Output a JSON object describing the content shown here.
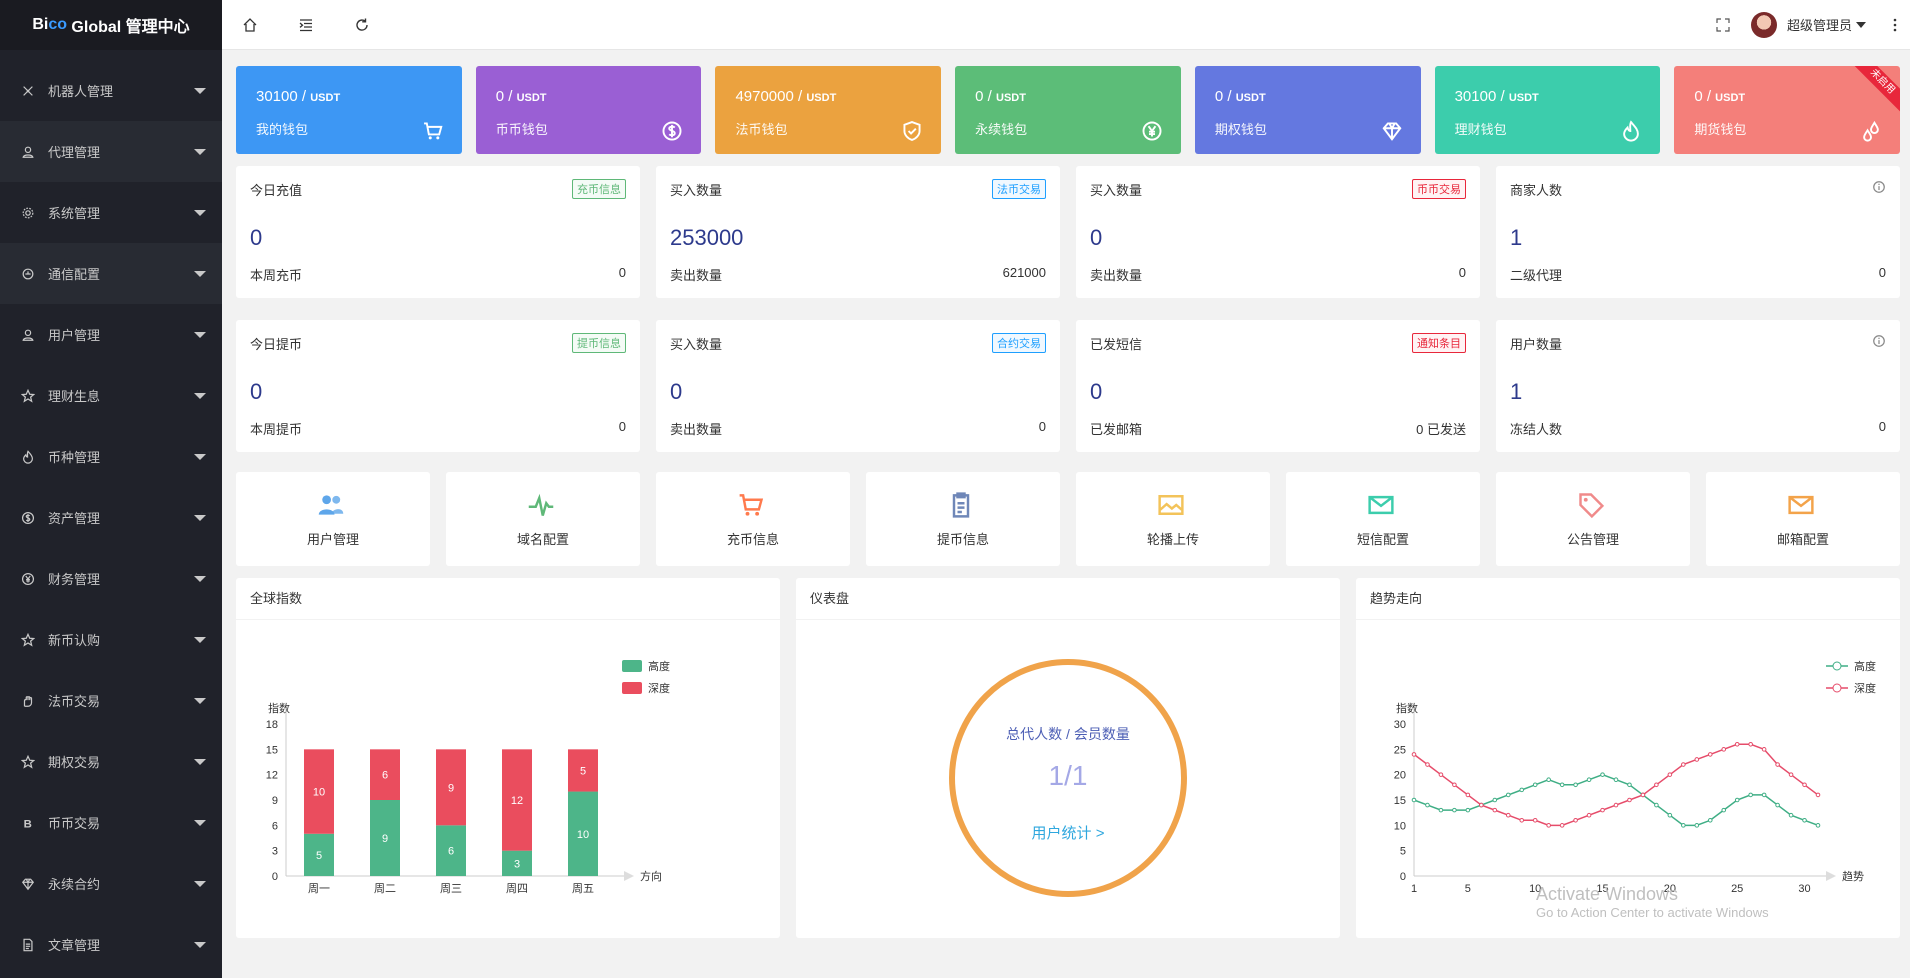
{
  "app": {
    "logo_prefix": "Bi",
    "logo_accent": "co",
    "logo_rest": " Global 管理中心"
  },
  "sidebar": {
    "items": [
      {
        "label": "机器人管理",
        "icon": "robot-icon"
      },
      {
        "label": "代理管理",
        "icon": "user-icon"
      },
      {
        "label": "系统管理",
        "icon": "gear-icon"
      },
      {
        "label": "通信配置",
        "icon": "signal-icon"
      },
      {
        "label": "用户管理",
        "icon": "user-icon"
      },
      {
        "label": "理财生息",
        "icon": "star-icon"
      },
      {
        "label": "币种管理",
        "icon": "fire-icon"
      },
      {
        "label": "资产管理",
        "icon": "dollar-icon"
      },
      {
        "label": "财务管理",
        "icon": "yen-icon"
      },
      {
        "label": "新币认购",
        "icon": "star-icon"
      },
      {
        "label": "法币交易",
        "icon": "hand-icon"
      },
      {
        "label": "期权交易",
        "icon": "star-icon"
      },
      {
        "label": "币币交易",
        "icon": "b-icon"
      },
      {
        "label": "永续合约",
        "icon": "diamond-icon"
      },
      {
        "label": "文章管理",
        "icon": "doc-icon"
      }
    ]
  },
  "header": {
    "username": "超级管理员"
  },
  "wallets": [
    {
      "amount": "30100 / ",
      "unit": "USDT",
      "name": "我的钱包",
      "color": "#3d97f4",
      "icon": "cart-icon"
    },
    {
      "amount": "0 / ",
      "unit": "USDT",
      "name": "币币钱包",
      "color": "#9a5fd4",
      "icon": "dollar-icon"
    },
    {
      "amount": "4970000 / ",
      "unit": "USDT",
      "name": "法币钱包",
      "color": "#eba23f",
      "icon": "shield-check-icon"
    },
    {
      "amount": "0 / ",
      "unit": "USDT",
      "name": "永续钱包",
      "color": "#5cbd78",
      "icon": "yen-icon"
    },
    {
      "amount": "0 / ",
      "unit": "USDT",
      "name": "期权钱包",
      "color": "#6478e0",
      "icon": "diamond-icon"
    },
    {
      "amount": "30100 / ",
      "unit": "USDT",
      "name": "理财钱包",
      "color": "#3ccdac",
      "icon": "fire-icon"
    },
    {
      "amount": "0 / ",
      "unit": "USDT",
      "name": "期货钱包",
      "color": "#f47f7a",
      "icon": "drops-icon",
      "ribbon": "未启用"
    }
  ],
  "stats_row1": [
    {
      "title": "今日充值",
      "badge": "充币信息",
      "badge_color": "green",
      "value": "0",
      "bottom_label": "本周充币",
      "bottom_value": "0"
    },
    {
      "title": "买入数量",
      "badge": "法币交易",
      "badge_color": "blue",
      "value": "253000",
      "bottom_label": "卖出数量",
      "bottom_value": "621000"
    },
    {
      "title": "买入数量",
      "badge": "币币交易",
      "badge_color": "red2",
      "value": "0",
      "bottom_label": "卖出数量",
      "bottom_value": "0"
    },
    {
      "title": "商家人数",
      "badge": "",
      "badge_color": "info",
      "value": "1",
      "bottom_label": "二级代理",
      "bottom_value": "0"
    }
  ],
  "stats_row2": [
    {
      "title": "今日提币",
      "badge": "提币信息",
      "badge_color": "green",
      "value": "0",
      "bottom_label": "本周提币",
      "bottom_value": "0"
    },
    {
      "title": "买入数量",
      "badge": "合约交易",
      "badge_color": "blue",
      "value": "0",
      "bottom_label": "卖出数量",
      "bottom_value": "0"
    },
    {
      "title": "已发短信",
      "badge": "通知条目",
      "badge_color": "red2",
      "value": "0",
      "bottom_label": "已发邮箱",
      "bottom_value": "0 已发送"
    },
    {
      "title": "用户数量",
      "badge": "",
      "badge_color": "info",
      "value": "1",
      "bottom_label": "冻结人数",
      "bottom_value": "0"
    }
  ],
  "quick": [
    {
      "label": "用户管理",
      "icon": "users-icon",
      "color": "#5ea6ea"
    },
    {
      "label": "域名配置",
      "icon": "pulse-icon",
      "color": "#5fb878"
    },
    {
      "label": "充币信息",
      "icon": "cart-icon",
      "color": "#ff7a4d"
    },
    {
      "label": "提币信息",
      "icon": "clipboard-icon",
      "color": "#6f87b8"
    },
    {
      "label": "轮播上传",
      "icon": "image-icon",
      "color": "#f3c35a"
    },
    {
      "label": "短信配置",
      "icon": "mail-icon",
      "color": "#3ccdac"
    },
    {
      "label": "公告管理",
      "icon": "tag-icon",
      "color": "#f08a8a"
    },
    {
      "label": "邮箱配置",
      "icon": "mail-icon",
      "color": "#f3a34a"
    }
  ],
  "panels": {
    "bar_title": "全球指数",
    "gauge_title": "仪表盘",
    "line_title": "趋势走向",
    "gauge": {
      "label": "总代人数 / 会员数量",
      "value": "1/1",
      "link": "用户统计 >"
    }
  },
  "chart_data": [
    {
      "type": "bar",
      "stacked": true,
      "title": "",
      "ylabel": "指数",
      "xlabel": "方向",
      "categories": [
        "周一",
        "周二",
        "周三",
        "周四",
        "周五"
      ],
      "series": [
        {
          "name": "高度",
          "color": "#4db589",
          "values": [
            5,
            9,
            6,
            3,
            10
          ]
        },
        {
          "name": "深度",
          "color": "#ea4d5e",
          "values": [
            10,
            6,
            9,
            12,
            5
          ]
        }
      ],
      "yticks": [
        0,
        3,
        6,
        9,
        12,
        15,
        18
      ],
      "ylim": [
        0,
        18
      ],
      "legend": "top-right"
    },
    {
      "type": "line",
      "title": "",
      "ylabel": "指数",
      "xlabel": "趋势",
      "x": [
        1,
        2,
        3,
        4,
        5,
        6,
        7,
        8,
        9,
        10,
        11,
        12,
        13,
        14,
        15,
        16,
        17,
        18,
        19,
        20,
        21,
        22,
        23,
        24,
        25,
        26,
        27,
        28,
        29,
        30,
        31
      ],
      "xticks": [
        1,
        5,
        10,
        15,
        20,
        25,
        30
      ],
      "series": [
        {
          "name": "高度",
          "color": "#3fae85",
          "values": [
            15,
            14,
            13,
            13,
            13,
            14,
            15,
            16,
            17,
            18,
            19,
            18,
            18,
            19,
            20,
            19,
            18,
            16,
            14,
            12,
            10,
            10,
            11,
            13,
            15,
            16,
            16,
            14,
            12,
            11,
            10
          ]
        },
        {
          "name": "深度",
          "color": "#e64c6a",
          "values": [
            24,
            22,
            20,
            18,
            16,
            14,
            13,
            12,
            11,
            11,
            10,
            10,
            11,
            12,
            13,
            14,
            15,
            16,
            18,
            20,
            22,
            23,
            24,
            25,
            26,
            26,
            25,
            22,
            20,
            18,
            16
          ]
        }
      ],
      "yticks": [
        0,
        5,
        10,
        15,
        20,
        25,
        30
      ],
      "ylim": [
        0,
        30
      ],
      "legend": "top-right"
    }
  ],
  "watermark": {
    "line1": "Activate Windows",
    "line2": "Go to Action Center to activate Windows"
  }
}
